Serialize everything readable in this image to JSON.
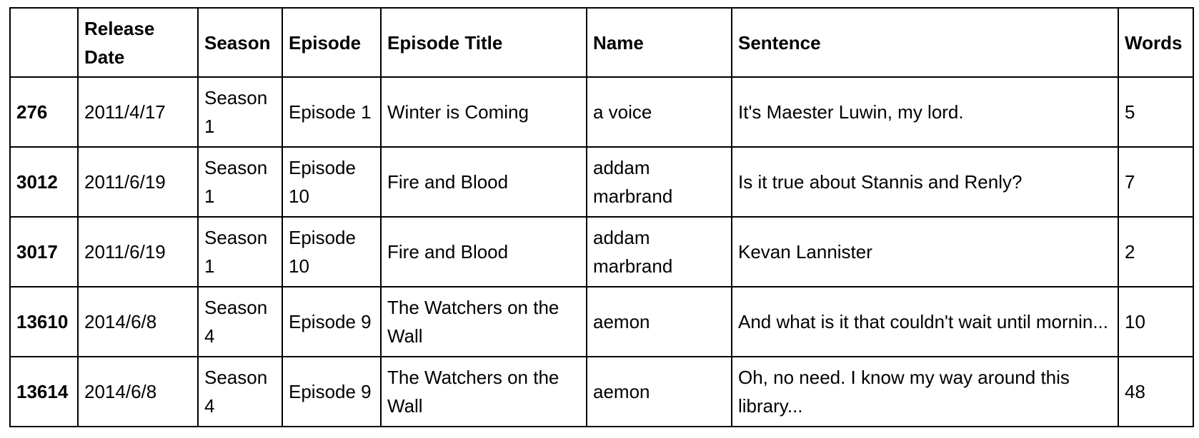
{
  "table": {
    "headers": [
      "",
      "Release Date",
      "Season",
      "Episode",
      "Episode Title",
      "Name",
      "Sentence",
      "Words"
    ],
    "rows": [
      [
        "276",
        "2011/4/17",
        "Season 1",
        "Episode 1",
        "Winter is Coming",
        "a voice",
        "It's Maester Luwin, my lord.",
        "5"
      ],
      [
        "3012",
        "2011/6/19",
        "Season 1",
        "Episode 10",
        "Fire and Blood",
        "addam marbrand",
        "Is it true about Stannis and Renly?",
        "7"
      ],
      [
        "3017",
        "2011/6/19",
        "Season 1",
        "Episode 10",
        "Fire and Blood",
        "addam marbrand",
        "Kevan Lannister",
        "2"
      ],
      [
        "13610",
        "2014/6/8",
        "Season 4",
        "Episode 9",
        "The Watchers on the Wall",
        "aemon",
        "And what is it that couldn't wait until mornin...",
        "10"
      ],
      [
        "13614",
        "2014/6/8",
        "Season 4",
        "Episode 9",
        "The Watchers on the Wall",
        "aemon",
        "Oh, no need. I know my way around this library...",
        "48"
      ]
    ]
  }
}
